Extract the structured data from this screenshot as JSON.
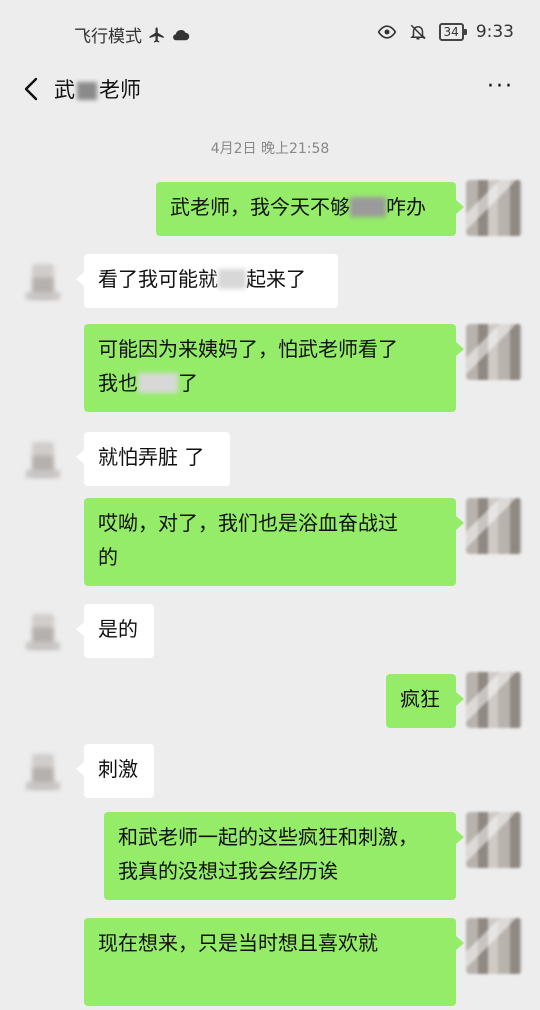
{
  "status_bar": {
    "mode_label": "飞行模式",
    "battery": "34",
    "time": "9:33",
    "icons": [
      "airplane-icon",
      "cloud-icon",
      "eye-icon",
      "bell-off-icon",
      "battery-icon"
    ]
  },
  "header": {
    "title_part1": "武",
    "title_part2": "老师",
    "more_label": "···"
  },
  "timestamp": "4月2日 晚上21:58",
  "messages": [
    {
      "side": "mine",
      "text_a": "武老师，我今天不够",
      "text_b": "咋办"
    },
    {
      "side": "theirs",
      "text_a": "看了我可能就",
      "text_b": "起来了"
    },
    {
      "side": "mine",
      "line1": "可能因为来姨妈了，怕武老师看了",
      "line2_a": "我也",
      "line2_b": "了"
    },
    {
      "side": "theirs",
      "text": "就怕弄脏 了"
    },
    {
      "side": "mine",
      "line1": "哎呦，对了，我们也是浴血奋战过",
      "line2": "的"
    },
    {
      "side": "theirs",
      "text": "是的"
    },
    {
      "side": "mine",
      "text": "疯狂"
    },
    {
      "side": "theirs",
      "text": "刺激"
    },
    {
      "side": "mine",
      "line1": "和武老师一起的这些疯狂和刺激，",
      "line2": "我真的没想过我会经历诶"
    },
    {
      "side": "mine",
      "line1": "现在想来，只是当时想且喜欢就"
    }
  ],
  "colors": {
    "background": "#ededed",
    "my_bubble": "#95ec69",
    "their_bubble": "#ffffff"
  }
}
